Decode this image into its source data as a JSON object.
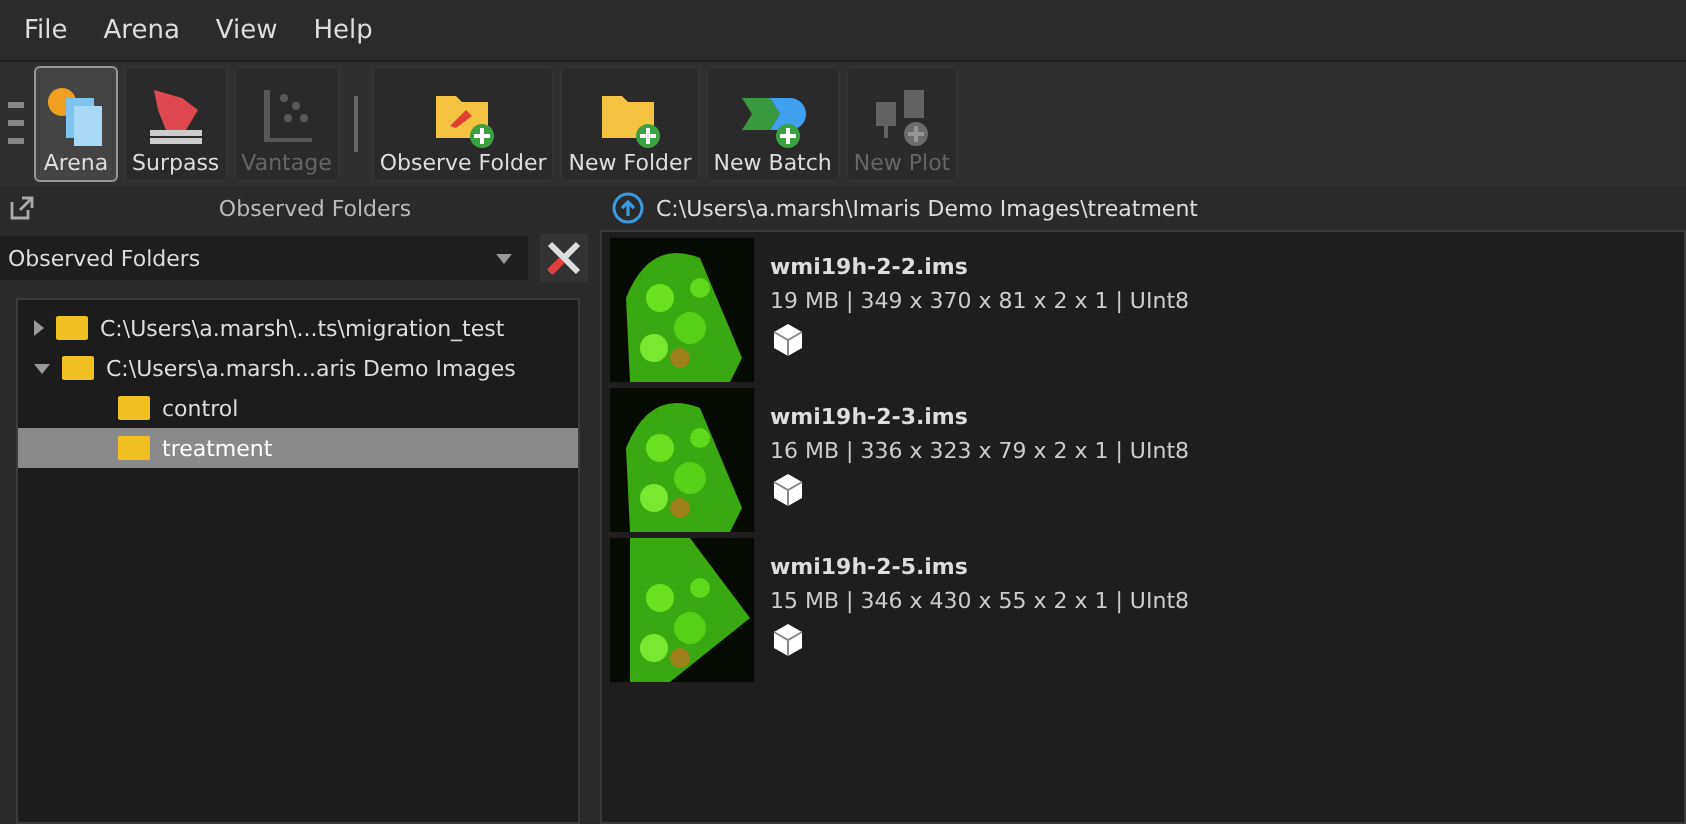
{
  "menu": [
    "File",
    "Arena",
    "View",
    "Help"
  ],
  "toolbar": [
    {
      "kind": "arena",
      "label": "Arena",
      "selected": true,
      "disabled": false
    },
    {
      "kind": "surpass",
      "label": "Surpass",
      "selected": false,
      "disabled": false
    },
    {
      "kind": "vantage",
      "label": "Vantage",
      "selected": false,
      "disabled": true
    },
    {
      "kind": "observe",
      "label": "Observe Folder",
      "selected": false,
      "disabled": false
    },
    {
      "kind": "folder",
      "label": "New Folder",
      "selected": false,
      "disabled": false
    },
    {
      "kind": "batch",
      "label": "New Batch",
      "selected": false,
      "disabled": false
    },
    {
      "kind": "plot",
      "label": "New Plot",
      "selected": false,
      "disabled": true
    }
  ],
  "left_panel": {
    "title": "Observed Folders",
    "dropdown": "Observed Folders",
    "tree": [
      {
        "label": "C:\\Users\\a.marsh\\...ts\\migration_test",
        "expanded": false,
        "selected": false
      },
      {
        "label": "C:\\Users\\a.marsh...aris Demo Images",
        "expanded": true,
        "selected": false,
        "children": [
          {
            "label": "control",
            "selected": false
          },
          {
            "label": "treatment",
            "selected": true
          }
        ]
      }
    ]
  },
  "right_panel": {
    "path": "C:\\Users\\a.marsh\\Imaris Demo Images\\treatment",
    "files": [
      {
        "name": "wmi19h-2-2.ims",
        "info": "19 MB | 349 x 370 x 81 x 2 x 1 | UInt8"
      },
      {
        "name": "wmi19h-2-3.ims",
        "info": "16 MB | 336 x 323 x 79 x 2 x 1 | UInt8"
      },
      {
        "name": "wmi19h-2-5.ims",
        "info": "15 MB | 346 x 430 x 55 x 2 x 1 | UInt8"
      }
    ]
  }
}
